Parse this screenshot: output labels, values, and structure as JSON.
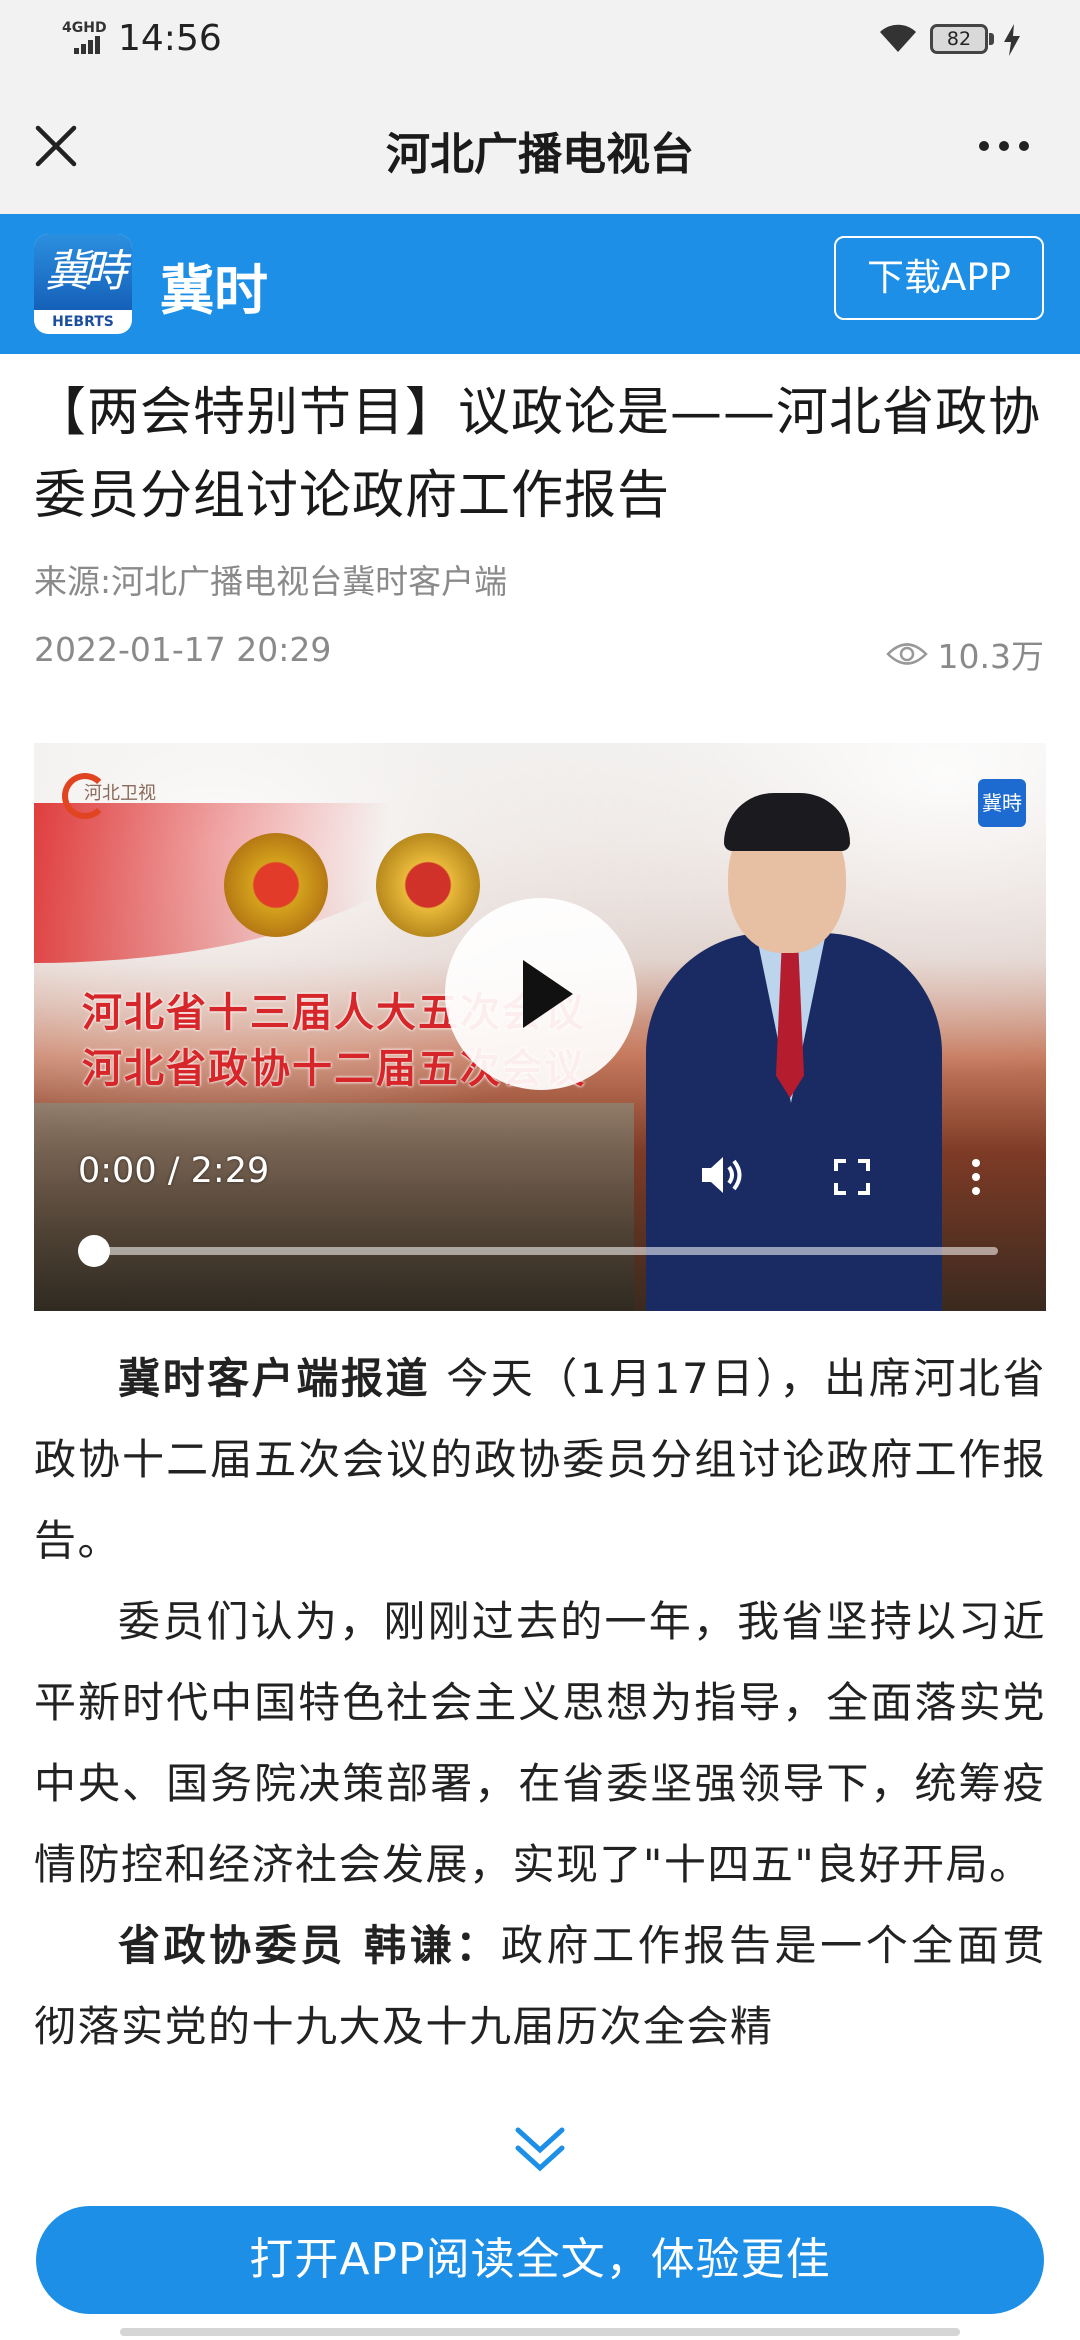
{
  "status_bar": {
    "network": "4GHD",
    "time": "14:56",
    "battery": "82"
  },
  "nav": {
    "title": "河北广播电视台"
  },
  "banner": {
    "logo_text": "冀時",
    "logo_sub": "HEBRTS",
    "brand": "冀时",
    "download_label": "下载APP"
  },
  "article": {
    "title": "【两会特别节目】议政论是——河北省政协委员分组讨论政府工作报告",
    "source": "来源:河北广播电视台冀时客户端",
    "date": "2022-01-17 20:29",
    "views": "10.3万"
  },
  "video": {
    "tv_logo": "河北卫视",
    "overlay_line1": "河北省十三届人大五次会议",
    "overlay_line2": "河北省政协十二届五次会议",
    "corner_logo": "冀時",
    "time": "0:00 / 2:29",
    "progress": 0
  },
  "body": {
    "p1_lead": "冀时客户端报道",
    "p1_text": " 今天（1月17日），出席河北省政协十二届五次会议的政协委员分组讨论政府工作报告。",
    "p2_text": "委员们认为，刚刚过去的一年，我省坚持以习近平新时代中国特色社会主义思想为指导，全面落实党中央、国务院决策部署，在省委坚强领导下，统筹疫情防控和经济社会发展，实现了\"十四五\"良好开局。",
    "p3_lead": "省政协委员 韩谦：",
    "p3_text": "政府工作报告是一个全面贯彻落实党的十九大及十九届历次全会精"
  },
  "footer": {
    "open_app_label": "打开APP阅读全文，体验更佳"
  },
  "colors": {
    "brand_blue": "#1d8fe6",
    "nav_bg": "#f2f2f2"
  }
}
